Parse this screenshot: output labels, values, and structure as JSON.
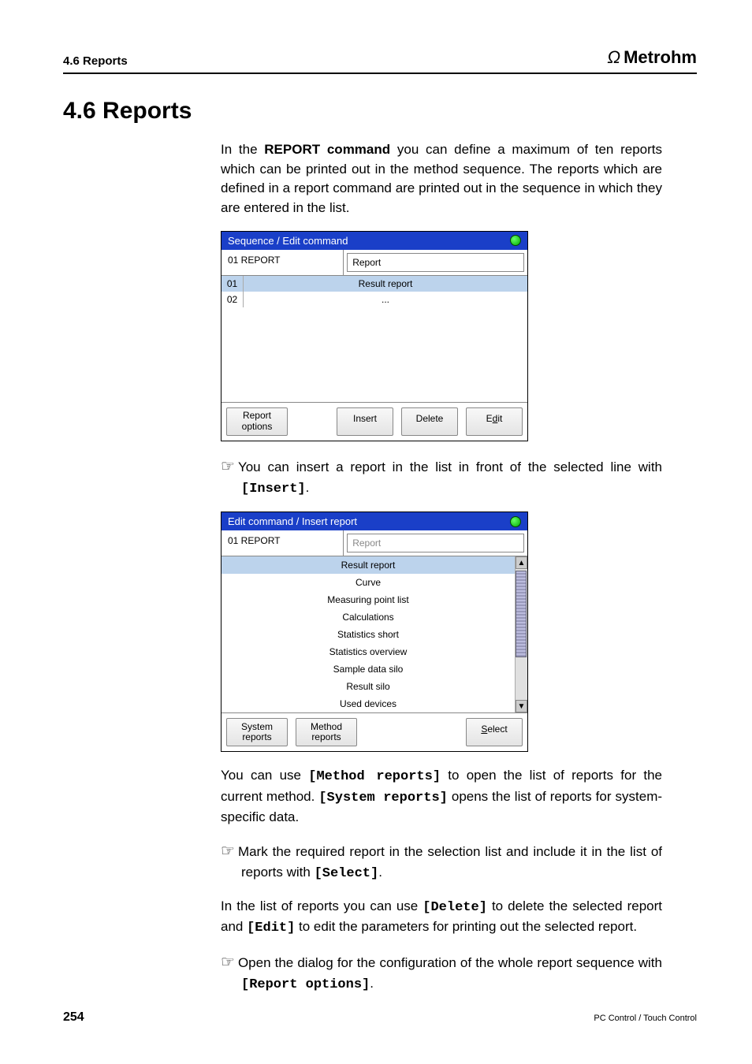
{
  "header": {
    "section": "4.6 Reports",
    "brand": "Metrohm"
  },
  "title": "4.6  Reports",
  "intro": {
    "t1a": "In the ",
    "t1b": "REPORT command",
    "t1c": " you can define a maximum of ten reports which can be printed out in the method sequence. The reports which are defined in a report command are printed out in the sequence in which they are entered in the list."
  },
  "dlg1": {
    "title": "Sequence / Edit command",
    "row_left": "01   REPORT",
    "row_right": "Report",
    "rows": [
      {
        "n": "01",
        "label": "Result report"
      },
      {
        "n": "02",
        "label": "..."
      }
    ],
    "buttons": {
      "options_l1": "Report",
      "options_l2": "options",
      "insert": "Insert",
      "delete": "Delete",
      "edit_pre": "E",
      "edit_u": "d",
      "edit_post": "it"
    }
  },
  "tip1": {
    "a": "You can insert a report in the list in front of the selected line with ",
    "b": "[Insert]",
    "c": "."
  },
  "dlg2": {
    "title": "Edit command / Insert report",
    "row_left": "01   REPORT",
    "row_right": "Report",
    "options": [
      "Result report",
      "Curve",
      "Measuring point list",
      "Calculations",
      "Statistics short",
      "Statistics overview",
      "Sample data silo",
      "Result silo",
      "Used devices"
    ],
    "buttons": {
      "sys_l1": "System",
      "sys_l2": "reports",
      "meth_l1": "Method",
      "meth_l2": "reports",
      "select_pre": "",
      "select_u": "S",
      "select_post": "elect"
    }
  },
  "para2": {
    "a": "You can use ",
    "b": "[Method reports]",
    "c": " to open the list of reports for the current method. ",
    "d": "[System reports]",
    "e": " opens the list of reports for system-specific data."
  },
  "tip2": {
    "a": "Mark the required report in the selection list and include it in the list of reports with ",
    "b": "[Select]",
    "c": "."
  },
  "para3": {
    "a": "In the list of reports you can use ",
    "b": "[Delete]",
    "c": " to delete the selected report and ",
    "d": "[Edit]",
    "e": " to edit the parameters for printing out the selected report."
  },
  "tip3": {
    "a": "Open the dialog for the configuration of the whole report sequence with ",
    "b": "[Report options]",
    "c": "."
  },
  "footer": {
    "page": "254",
    "right": "PC Control / Touch Control"
  }
}
